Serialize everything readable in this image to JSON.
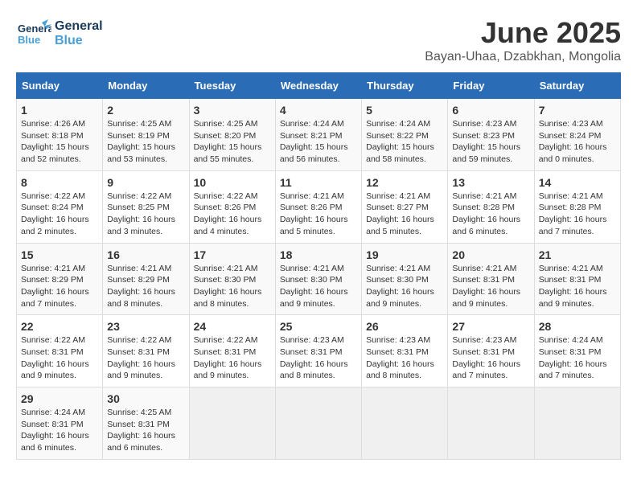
{
  "header": {
    "logo_line1": "General",
    "logo_line2": "Blue",
    "title": "June 2025",
    "subtitle": "Bayan-Uhaa, Dzabkhan, Mongolia"
  },
  "weekdays": [
    "Sunday",
    "Monday",
    "Tuesday",
    "Wednesday",
    "Thursday",
    "Friday",
    "Saturday"
  ],
  "weeks": [
    [
      {
        "day": "1",
        "info": "Sunrise: 4:26 AM\nSunset: 8:18 PM\nDaylight: 15 hours\nand 52 minutes."
      },
      {
        "day": "2",
        "info": "Sunrise: 4:25 AM\nSunset: 8:19 PM\nDaylight: 15 hours\nand 53 minutes."
      },
      {
        "day": "3",
        "info": "Sunrise: 4:25 AM\nSunset: 8:20 PM\nDaylight: 15 hours\nand 55 minutes."
      },
      {
        "day": "4",
        "info": "Sunrise: 4:24 AM\nSunset: 8:21 PM\nDaylight: 15 hours\nand 56 minutes."
      },
      {
        "day": "5",
        "info": "Sunrise: 4:24 AM\nSunset: 8:22 PM\nDaylight: 15 hours\nand 58 minutes."
      },
      {
        "day": "6",
        "info": "Sunrise: 4:23 AM\nSunset: 8:23 PM\nDaylight: 15 hours\nand 59 minutes."
      },
      {
        "day": "7",
        "info": "Sunrise: 4:23 AM\nSunset: 8:24 PM\nDaylight: 16 hours\nand 0 minutes."
      }
    ],
    [
      {
        "day": "8",
        "info": "Sunrise: 4:22 AM\nSunset: 8:24 PM\nDaylight: 16 hours\nand 2 minutes."
      },
      {
        "day": "9",
        "info": "Sunrise: 4:22 AM\nSunset: 8:25 PM\nDaylight: 16 hours\nand 3 minutes."
      },
      {
        "day": "10",
        "info": "Sunrise: 4:22 AM\nSunset: 8:26 PM\nDaylight: 16 hours\nand 4 minutes."
      },
      {
        "day": "11",
        "info": "Sunrise: 4:21 AM\nSunset: 8:26 PM\nDaylight: 16 hours\nand 5 minutes."
      },
      {
        "day": "12",
        "info": "Sunrise: 4:21 AM\nSunset: 8:27 PM\nDaylight: 16 hours\nand 5 minutes."
      },
      {
        "day": "13",
        "info": "Sunrise: 4:21 AM\nSunset: 8:28 PM\nDaylight: 16 hours\nand 6 minutes."
      },
      {
        "day": "14",
        "info": "Sunrise: 4:21 AM\nSunset: 8:28 PM\nDaylight: 16 hours\nand 7 minutes."
      }
    ],
    [
      {
        "day": "15",
        "info": "Sunrise: 4:21 AM\nSunset: 8:29 PM\nDaylight: 16 hours\nand 7 minutes."
      },
      {
        "day": "16",
        "info": "Sunrise: 4:21 AM\nSunset: 8:29 PM\nDaylight: 16 hours\nand 8 minutes."
      },
      {
        "day": "17",
        "info": "Sunrise: 4:21 AM\nSunset: 8:30 PM\nDaylight: 16 hours\nand 8 minutes."
      },
      {
        "day": "18",
        "info": "Sunrise: 4:21 AM\nSunset: 8:30 PM\nDaylight: 16 hours\nand 9 minutes."
      },
      {
        "day": "19",
        "info": "Sunrise: 4:21 AM\nSunset: 8:30 PM\nDaylight: 16 hours\nand 9 minutes."
      },
      {
        "day": "20",
        "info": "Sunrise: 4:21 AM\nSunset: 8:31 PM\nDaylight: 16 hours\nand 9 minutes."
      },
      {
        "day": "21",
        "info": "Sunrise: 4:21 AM\nSunset: 8:31 PM\nDaylight: 16 hours\nand 9 minutes."
      }
    ],
    [
      {
        "day": "22",
        "info": "Sunrise: 4:22 AM\nSunset: 8:31 PM\nDaylight: 16 hours\nand 9 minutes."
      },
      {
        "day": "23",
        "info": "Sunrise: 4:22 AM\nSunset: 8:31 PM\nDaylight: 16 hours\nand 9 minutes."
      },
      {
        "day": "24",
        "info": "Sunrise: 4:22 AM\nSunset: 8:31 PM\nDaylight: 16 hours\nand 9 minutes."
      },
      {
        "day": "25",
        "info": "Sunrise: 4:23 AM\nSunset: 8:31 PM\nDaylight: 16 hours\nand 8 minutes."
      },
      {
        "day": "26",
        "info": "Sunrise: 4:23 AM\nSunset: 8:31 PM\nDaylight: 16 hours\nand 8 minutes."
      },
      {
        "day": "27",
        "info": "Sunrise: 4:23 AM\nSunset: 8:31 PM\nDaylight: 16 hours\nand 7 minutes."
      },
      {
        "day": "28",
        "info": "Sunrise: 4:24 AM\nSunset: 8:31 PM\nDaylight: 16 hours\nand 7 minutes."
      }
    ],
    [
      {
        "day": "29",
        "info": "Sunrise: 4:24 AM\nSunset: 8:31 PM\nDaylight: 16 hours\nand 6 minutes."
      },
      {
        "day": "30",
        "info": "Sunrise: 4:25 AM\nSunset: 8:31 PM\nDaylight: 16 hours\nand 6 minutes."
      },
      null,
      null,
      null,
      null,
      null
    ]
  ]
}
